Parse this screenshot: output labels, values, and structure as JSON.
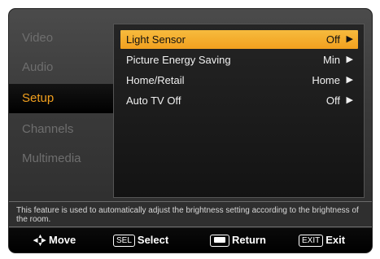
{
  "sidebar": {
    "items": [
      {
        "label": "Video",
        "active": false
      },
      {
        "label": "Audio",
        "active": false
      },
      {
        "label": "Setup",
        "active": true
      },
      {
        "label": "Channels",
        "active": false
      },
      {
        "label": "Multimedia",
        "active": false
      }
    ]
  },
  "menu": {
    "rows": [
      {
        "label": "Light Sensor",
        "value": "Off",
        "arrow": "▶",
        "selected": true
      },
      {
        "label": "Picture Energy Saving",
        "value": "Min",
        "arrow": "▶",
        "selected": false
      },
      {
        "label": "Home/Retail",
        "value": "Home",
        "arrow": "▶",
        "selected": false
      },
      {
        "label": "Auto TV Off",
        "value": "Off",
        "arrow": "▶",
        "selected": false
      }
    ]
  },
  "help_text": "This feature is used to automatically adjust the brightness setting according to the brightness of the room.",
  "footer": {
    "move_label": "Move",
    "select_key": "SEL",
    "select_label": "Select",
    "return_label": "Return",
    "exit_key": "EXIT",
    "exit_label": "Exit"
  },
  "colors": {
    "accent": "#f2a01e",
    "inactive_text": "#6e6e6e",
    "background": "#3a3a3a"
  },
  "icons": {
    "move": "dpad-arrows-icon",
    "return": "return-key-icon"
  }
}
